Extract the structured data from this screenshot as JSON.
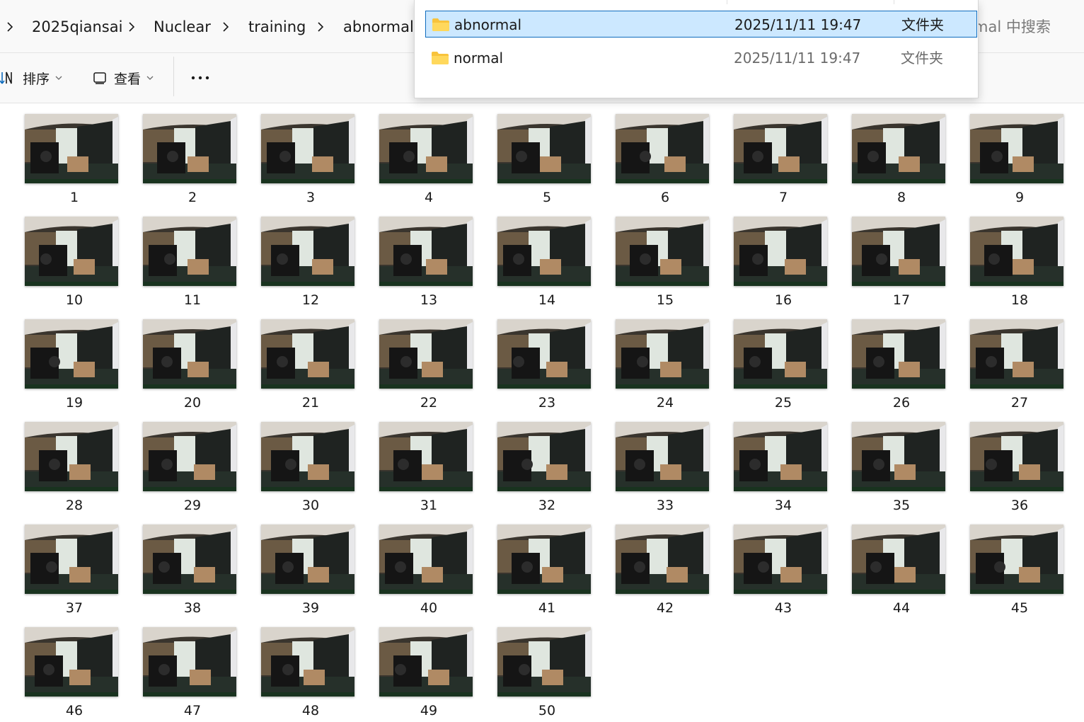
{
  "breadcrumb": {
    "items": [
      "2025qiansai",
      "Nuclear",
      "training",
      "abnormal"
    ]
  },
  "search": {
    "hint": "mal 中搜索"
  },
  "toolbar": {
    "sort_label": "排序",
    "view_label": "查看",
    "more_label": "..."
  },
  "dropdown": {
    "rows": [
      {
        "name": "abnormal",
        "date": "2025/11/11 19:47",
        "type": "文件夹",
        "selected": true
      },
      {
        "name": "normal",
        "date": "2025/11/11 19:47",
        "type": "文件夹",
        "selected": false
      }
    ]
  },
  "files": [
    {
      "label": "1"
    },
    {
      "label": "2"
    },
    {
      "label": "3"
    },
    {
      "label": "4"
    },
    {
      "label": "5"
    },
    {
      "label": "6"
    },
    {
      "label": "7"
    },
    {
      "label": "8"
    },
    {
      "label": "9"
    },
    {
      "label": "10"
    },
    {
      "label": "11"
    },
    {
      "label": "12"
    },
    {
      "label": "13"
    },
    {
      "label": "14"
    },
    {
      "label": "15"
    },
    {
      "label": "16"
    },
    {
      "label": "17"
    },
    {
      "label": "18"
    },
    {
      "label": "19"
    },
    {
      "label": "20"
    },
    {
      "label": "21"
    },
    {
      "label": "22"
    },
    {
      "label": "23"
    },
    {
      "label": "24"
    },
    {
      "label": "25"
    },
    {
      "label": "26"
    },
    {
      "label": "27"
    },
    {
      "label": "28"
    },
    {
      "label": "29"
    },
    {
      "label": "30"
    },
    {
      "label": "31"
    },
    {
      "label": "32"
    },
    {
      "label": "33"
    },
    {
      "label": "34"
    },
    {
      "label": "35"
    },
    {
      "label": "36"
    },
    {
      "label": "37"
    },
    {
      "label": "38"
    },
    {
      "label": "39"
    },
    {
      "label": "40"
    },
    {
      "label": "41"
    },
    {
      "label": "42"
    },
    {
      "label": "43"
    },
    {
      "label": "44"
    },
    {
      "label": "45"
    },
    {
      "label": "46"
    },
    {
      "label": "47"
    },
    {
      "label": "48"
    },
    {
      "label": "49"
    },
    {
      "label": "50"
    }
  ],
  "colors": {
    "selection_fill": "#cce8ff",
    "selection_border": "#0f6cbd",
    "folder_yellow": "#f8c33c",
    "accent_blue": "#0f6cbd"
  },
  "icons": {
    "sort": "sort-icon",
    "view": "view-icon",
    "more": "more-icon",
    "folder": "folder-icon",
    "chevron": "chevron-right-icon"
  }
}
